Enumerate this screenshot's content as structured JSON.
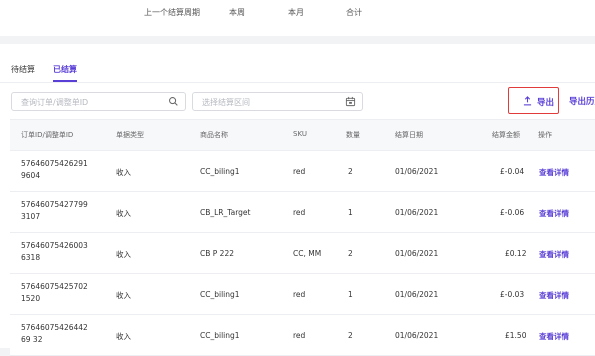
{
  "summary": {
    "labels": [
      "上一个结算周期",
      "本周",
      "本月",
      "合计"
    ]
  },
  "tabs": [
    {
      "label": "待结算",
      "active": false
    },
    {
      "label": "已结算",
      "active": true
    }
  ],
  "filters": {
    "search_placeholder": "查询订单/调整单ID",
    "date_placeholder": "选择结算区间"
  },
  "toolbar": {
    "export_label": "导出",
    "export_history_label": "导出历史"
  },
  "table": {
    "columns": [
      "订单ID/调整单ID",
      "单据类型",
      "商品名称",
      "SKU",
      "数量",
      "结算日期",
      "结算金额",
      "操作"
    ],
    "rows": [
      {
        "id": "576460754262919604",
        "type": "收入",
        "product": "CC_biling1",
        "sku": "red",
        "qty": "2",
        "date": "01/06/2021",
        "amount": "£-0.04",
        "action": "查看详情"
      },
      {
        "id": "576460754277993107",
        "type": "收入",
        "product": "CB_LR_Target",
        "sku": "red",
        "qty": "1",
        "date": "01/06/2021",
        "amount": "£-0.06",
        "action": "查看详情"
      },
      {
        "id": "576460754260036318",
        "type": "收入",
        "product": "CB P 222",
        "sku": "CC, MM",
        "qty": "2",
        "date": "01/06/2021",
        "amount": "£0.12",
        "action": "查看详情"
      },
      {
        "id": "576460754257021520",
        "type": "收入",
        "product": "CC_biling1",
        "sku": "red",
        "qty": "1",
        "date": "01/06/2021",
        "amount": "£-0.03",
        "action": "查看详情"
      },
      {
        "id": "5764607542644269 32",
        "type": "收入",
        "product": "CC_biling1",
        "sku": "red",
        "qty": "2",
        "date": "01/06/2021",
        "amount": "£1.50",
        "action": "查看详情"
      }
    ]
  },
  "colors": {
    "accent": "#5a3fd6",
    "highlight_border": "#e23b3b"
  },
  "icons": {
    "search": "search-icon",
    "calendar": "calendar-icon",
    "export": "upload-icon"
  }
}
